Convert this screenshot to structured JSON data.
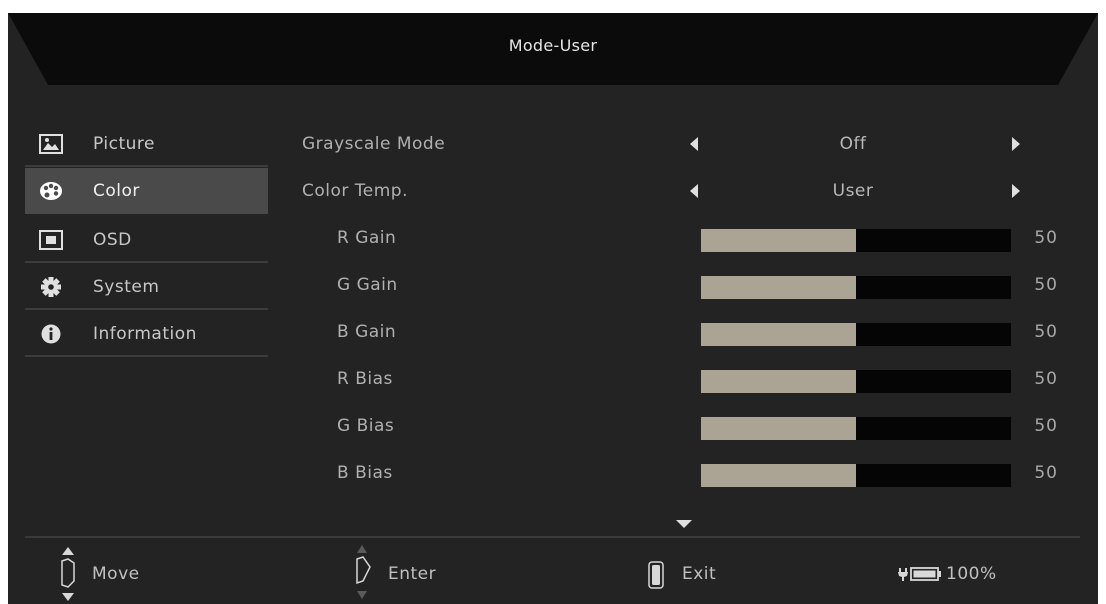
{
  "header": {
    "title": "Mode-User"
  },
  "sidebar": {
    "items": [
      {
        "label": "Picture"
      },
      {
        "label": "Color"
      },
      {
        "label": "OSD"
      },
      {
        "label": "System"
      },
      {
        "label": "Information"
      }
    ],
    "active_index": 1
  },
  "settings": {
    "grayscale": {
      "label": "Grayscale Mode",
      "value": "Off"
    },
    "color_temp": {
      "label": "Color Temp.",
      "value": "User"
    },
    "sliders": [
      {
        "label": "R Gain",
        "value": "50",
        "fraction": 0.5
      },
      {
        "label": "G Gain",
        "value": "50",
        "fraction": 0.5
      },
      {
        "label": "B Gain",
        "value": "50",
        "fraction": 0.5
      },
      {
        "label": "R Bias",
        "value": "50",
        "fraction": 0.5
      },
      {
        "label": "G Bias",
        "value": "50",
        "fraction": 0.5
      },
      {
        "label": "B Bias",
        "value": "50",
        "fraction": 0.5
      }
    ]
  },
  "footer": {
    "move": "Move",
    "enter": "Enter",
    "exit": "Exit",
    "battery": "100%"
  },
  "colors": {
    "background": "#232323",
    "active_item": "#4a4a4a",
    "slider_fill": "#aba393",
    "slider_track": "#050505"
  }
}
